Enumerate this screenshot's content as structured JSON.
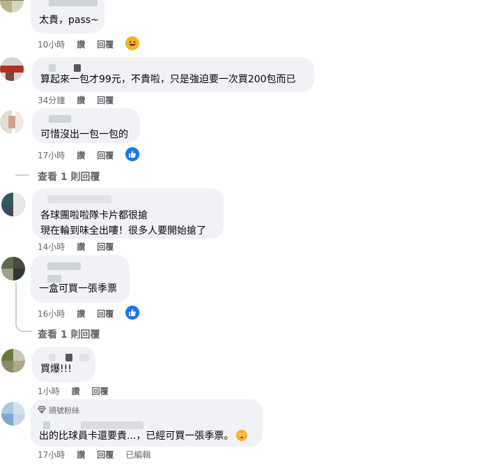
{
  "comments": [
    {
      "text_lines": [
        "太貴，pass~"
      ],
      "time": "10小時",
      "like": "讚",
      "reply": "回覆",
      "reaction": "haha-icon"
    },
    {
      "text_lines": [
        "算起來一包才99元，不貴啦，只是強迫要一次買200包而已"
      ],
      "time": "34分鐘",
      "like": "讚",
      "reply": "回覆"
    },
    {
      "text_lines": [
        "可惜沒出一包一包的"
      ],
      "time": "17小時",
      "like": "讚",
      "reply": "回覆",
      "reaction": "like-icon",
      "view_replies": "查看 1 則回覆"
    },
    {
      "text_lines": [
        "各球團啦啦隊卡片都很搶",
        "現在輪到味全出嘍！很多人要開始搶了"
      ],
      "time": "14小時",
      "like": "讚",
      "reply": "回覆"
    },
    {
      "text_lines": [
        "一盒可買一張季票"
      ],
      "time": "16小時",
      "like": "讚",
      "reply": "回覆",
      "reaction": "like-icon",
      "view_replies": "查看 1 則回覆"
    },
    {
      "text_lines": [
        "買爆!!!"
      ],
      "time": "1小時",
      "like": "讚",
      "reply": "回覆"
    },
    {
      "badge": "頭號粉絲",
      "text_lines": [
        "出的比球員卡還要貴...，已經可買一張季票。"
      ],
      "time": "17小時",
      "like": "讚",
      "reply": "回覆",
      "edited": "已編輯"
    }
  ],
  "colors": {
    "bubble": "#f0f2f5",
    "meta": "#65676b",
    "like_blue": "#1877f2",
    "haha_yellow": "#f7b125"
  }
}
